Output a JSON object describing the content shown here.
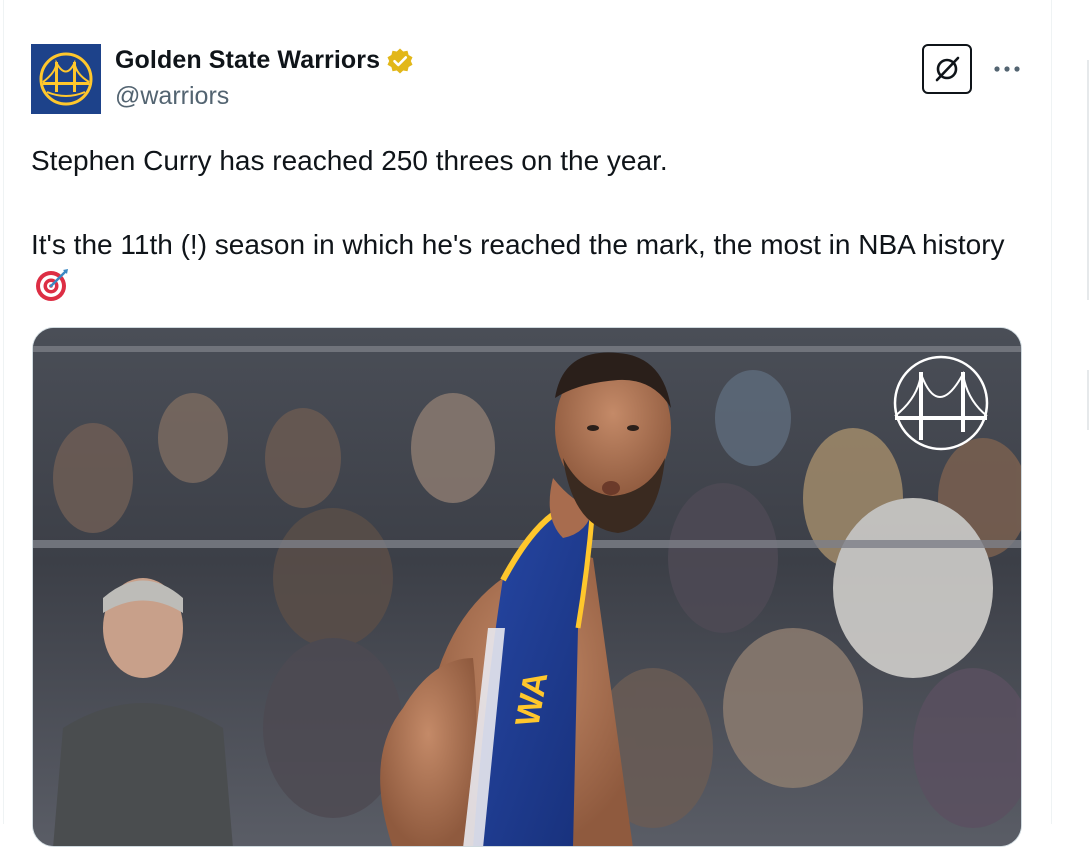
{
  "account": {
    "display_name": "Golden State Warriors",
    "handle": "@warriors",
    "verified_badge": "verified-gold-icon",
    "avatar_icon": "warriors-bridge-logo"
  },
  "actions": {
    "grok_icon": "grok-icon",
    "more_label": "···"
  },
  "tweet": {
    "line1": "Stephen Curry has reached 250 threes on the year.",
    "line2": "It's the 11th (!) season in which he's reached the mark, the most in NBA history",
    "emoji": "direct-hit-target-emoji"
  },
  "media": {
    "description_icon": "warriors-bridge-watermark",
    "jersey_text": "WA"
  },
  "colors": {
    "warriors_blue": "#1d428a",
    "warriors_gold": "#ffc72c",
    "text_primary": "#0f1419",
    "text_secondary": "#536471"
  }
}
